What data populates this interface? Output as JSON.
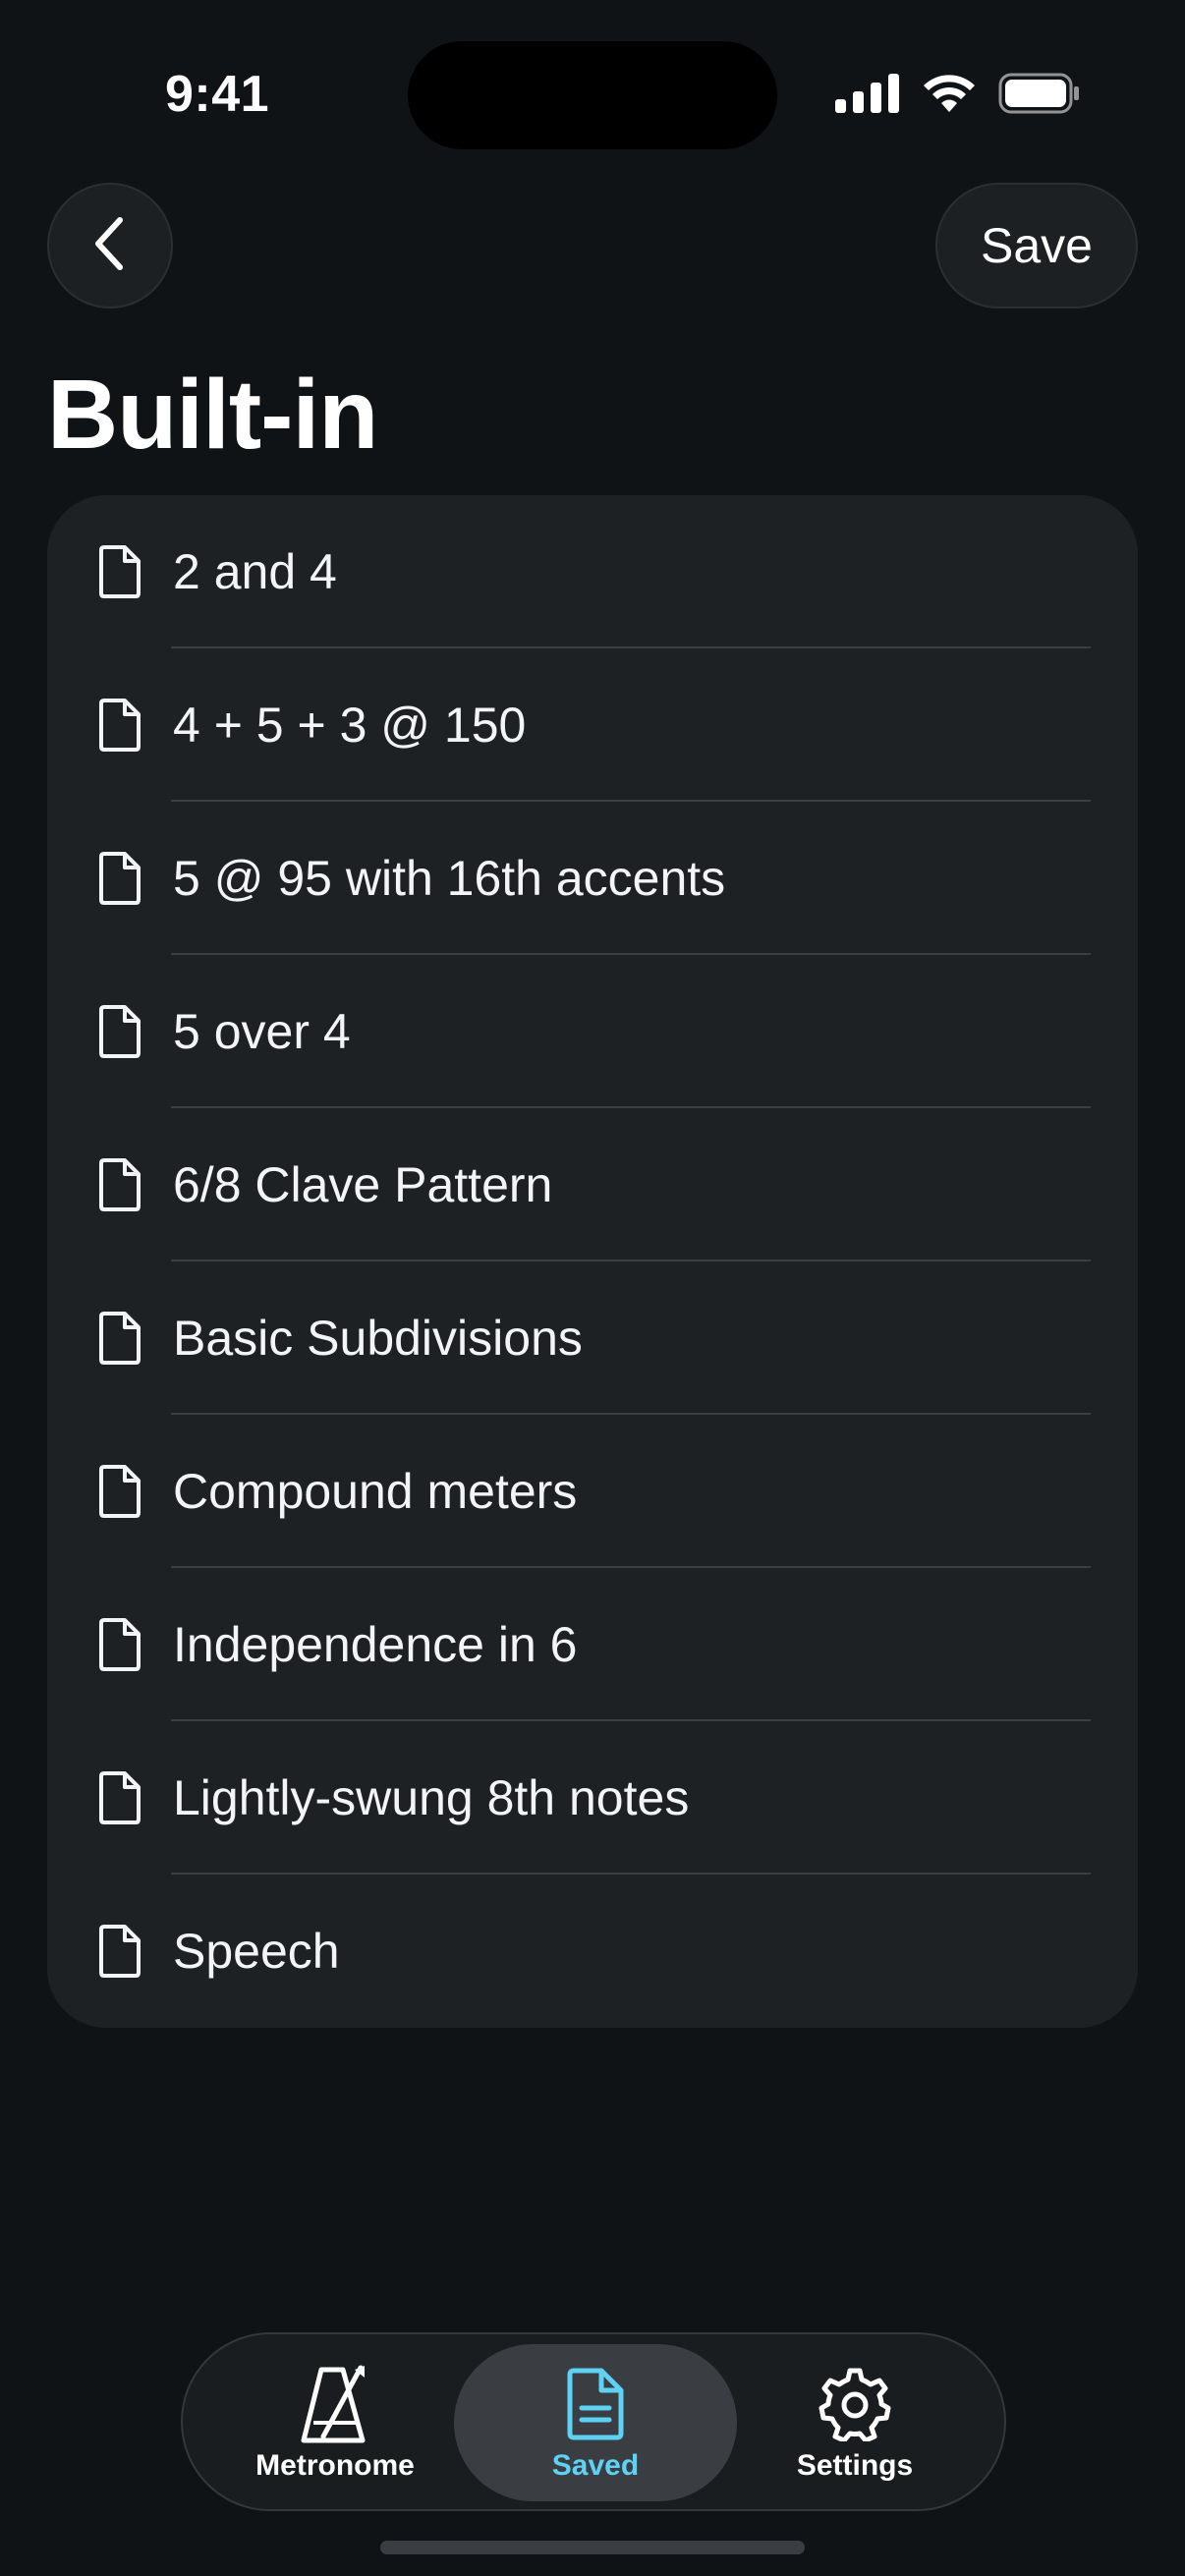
{
  "status_bar": {
    "time": "9:41"
  },
  "nav": {
    "back_icon": "chevron-left-icon",
    "save_label": "Save"
  },
  "page": {
    "title": "Built-in"
  },
  "list": {
    "item_icon": "document-icon",
    "items": [
      {
        "label": "2 and 4"
      },
      {
        "label": "4 + 5 + 3 @ 150"
      },
      {
        "label": "5 @ 95 with 16th accents"
      },
      {
        "label": "5 over 4"
      },
      {
        "label": "6/8 Clave Pattern"
      },
      {
        "label": "Basic Subdivisions"
      },
      {
        "label": "Compound meters"
      },
      {
        "label": "Independence in 6"
      },
      {
        "label": "Lightly-swung 8th notes"
      },
      {
        "label": "Speech"
      }
    ]
  },
  "tab_bar": {
    "active_tab": "Saved",
    "active_color": "#5fd1f4",
    "tabs": [
      {
        "label": "Metronome",
        "icon": "metronome-icon"
      },
      {
        "label": "Saved",
        "icon": "document-icon"
      },
      {
        "label": "Settings",
        "icon": "gear-icon"
      }
    ]
  },
  "colors": {
    "background": "#101316",
    "card": "#1d2124",
    "accent": "#5fd1f4"
  }
}
